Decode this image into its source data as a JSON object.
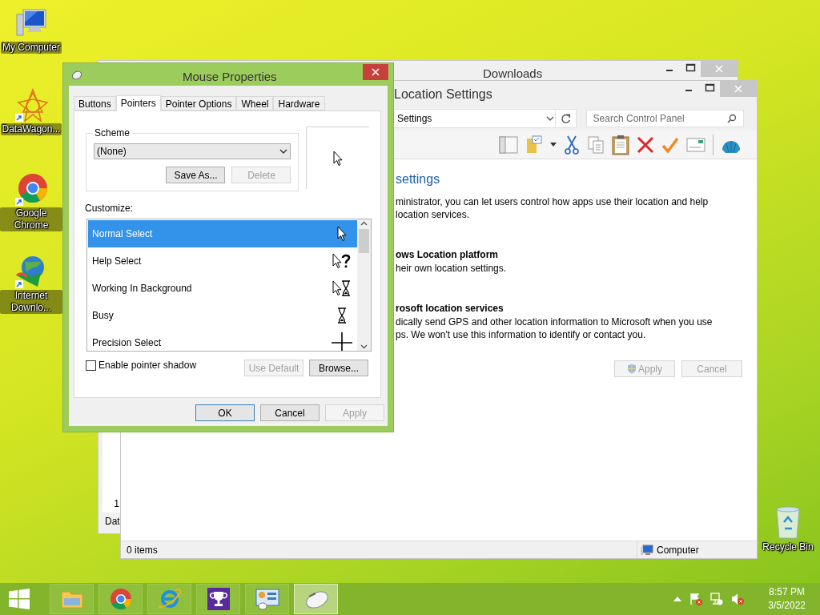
{
  "desktop_icons": [
    {
      "label": "My Computer",
      "kind": "computer"
    },
    {
      "label": "DataWagon...",
      "kind": "star"
    },
    {
      "label": "Google Chrome",
      "kind": "chrome"
    },
    {
      "label": "Internet Downlo...",
      "kind": "download"
    }
  ],
  "recycle_bin": {
    "label": "Recycle Bin"
  },
  "downloads_window": {
    "title": "Downloads",
    "cell": "1",
    "column_header": "Dat"
  },
  "location_window": {
    "title": "Location Settings",
    "address": "Settings",
    "search": {
      "placeholder": "Search Control Panel"
    },
    "heading": "settings",
    "intro_lines": [
      "ministrator, you can let users control how apps use their location and help",
      "location services."
    ],
    "sections": [
      {
        "title": "ows Location platform",
        "lines": [
          "heir own location settings."
        ]
      },
      {
        "title": "rosoft location services",
        "lines": [
          "dically send GPS and other location information to Microsoft when you use",
          "ps. We won't use this information to identify or contact you."
        ]
      }
    ],
    "buttons": [
      {
        "label": "Apply",
        "disabled": true,
        "shield": true
      },
      {
        "label": "Cancel",
        "disabled": true,
        "shield": false
      }
    ],
    "status": {
      "items": "0 items",
      "location": "Computer"
    }
  },
  "mouse_properties": {
    "title": "Mouse Properties",
    "tabs": [
      {
        "label": "Buttons",
        "selected": false
      },
      {
        "label": "Pointers",
        "selected": true
      },
      {
        "label": "Pointer Options",
        "selected": false
      },
      {
        "label": "Wheel",
        "selected": false
      },
      {
        "label": "Hardware",
        "selected": false
      }
    ],
    "scheme": {
      "label": "Scheme",
      "value": "(None)",
      "buttons": [
        {
          "label": "Save As...",
          "disabled": false
        },
        {
          "label": "Delete",
          "disabled": true
        }
      ]
    },
    "customize_label": "Customize:",
    "cursors": [
      {
        "name": "Normal Select",
        "kind": "arrow",
        "selected": true
      },
      {
        "name": "Help Select",
        "kind": "help",
        "selected": false
      },
      {
        "name": "Working In Background",
        "kind": "working",
        "selected": false
      },
      {
        "name": "Busy",
        "kind": "busy",
        "selected": false
      },
      {
        "name": "Precision Select",
        "kind": "cross",
        "selected": false
      }
    ],
    "shadow": {
      "label": "Enable pointer shadow",
      "checked": false
    },
    "list_buttons": [
      {
        "label": "Use Default",
        "disabled": true
      },
      {
        "label": "Browse...",
        "disabled": false
      }
    ],
    "footer_buttons": [
      {
        "label": "OK",
        "disabled": false,
        "default": true
      },
      {
        "label": "Cancel",
        "disabled": false,
        "default": false
      },
      {
        "label": "Apply",
        "disabled": true,
        "default": false
      }
    ]
  },
  "taskbar": {
    "items": [
      {
        "kind": "explorer",
        "active": false
      },
      {
        "kind": "chrome",
        "active": false
      },
      {
        "kind": "ie",
        "active": false
      },
      {
        "kind": "trophy",
        "active": false
      },
      {
        "kind": "control-panel",
        "active": false
      },
      {
        "kind": "mouse",
        "active": true
      }
    ],
    "time": "8:57 PM",
    "date": "3/5/2022"
  }
}
